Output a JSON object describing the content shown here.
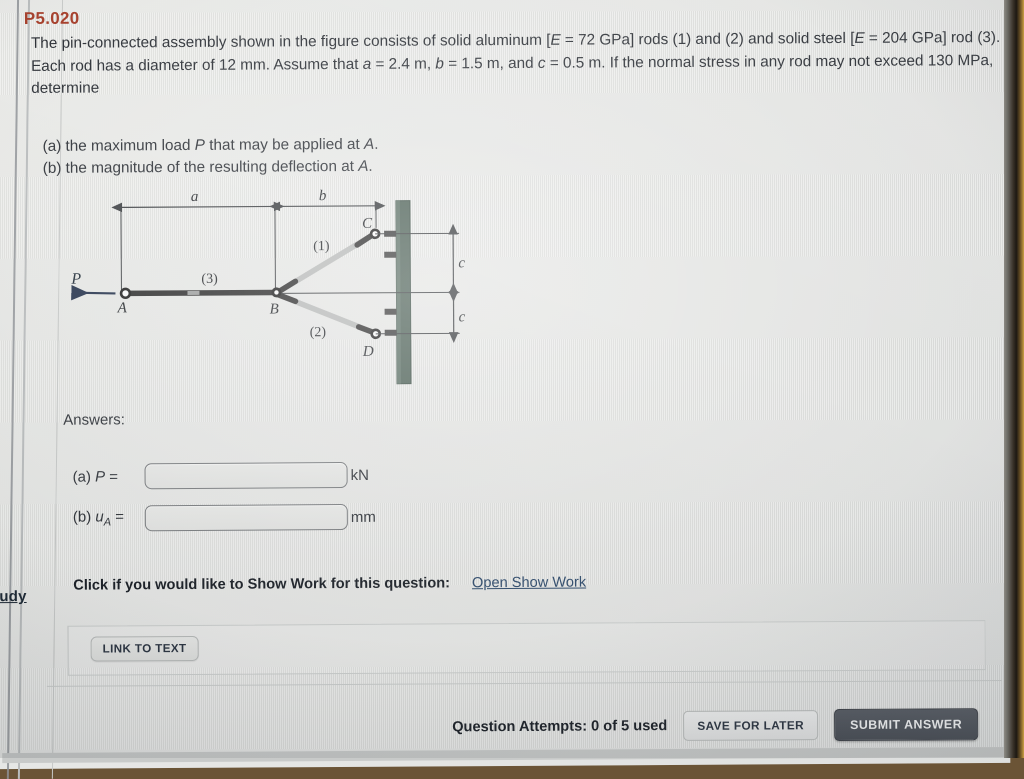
{
  "question": {
    "id": "P5.020",
    "id_color": "#a6402c",
    "statement_part1": "The pin-connected assembly shown in the figure consists of solid aluminum [",
    "statement_E1": "E",
    "statement_part2": " = 72 GPa] rods (1) and (2) and solid steel [",
    "statement_E2": "E",
    "statement_part3": " = 204 GPa] rod (3). Each rod has a diameter of 12 mm. Assume that ",
    "var_a": "a",
    "statement_part4": " = 2.4 m, ",
    "var_b": "b",
    "statement_part5": " = 1.5 m, and ",
    "var_c": "c",
    "statement_part6": " = 0.5 m. If the normal stress in any rod may not exceed 130 MPa, determine",
    "subquestions": [
      {
        "marker": "(a) the maximum load ",
        "italic": "P",
        "rest": " that may be applied at ",
        "italic2": "A",
        "end": "."
      },
      {
        "marker": "(b) the magnitude of the resulting deflection at ",
        "italic": "A",
        "rest": "",
        "italic2": "",
        "end": "."
      }
    ]
  },
  "figure": {
    "labels": {
      "dim_a": "a",
      "dim_b": "b",
      "dim_c_upper": "c",
      "dim_c_lower": "c",
      "load_P": "P",
      "joint_A": "A",
      "joint_B": "B",
      "joint_C": "C",
      "joint_D": "D",
      "rod1": "(1)",
      "rod2": "(2)",
      "rod3": "(3)"
    },
    "colors": {
      "wall": "#4d6157",
      "rod_dark": "#2b2b2b",
      "rod_light": "#b7b9b8",
      "line": "#3a3d40"
    }
  },
  "answers": {
    "heading": "Answers:",
    "rows": [
      {
        "label_prefix": "(a) ",
        "symbol": "P",
        "sub": "",
        "equals": " =",
        "value": "",
        "placeholder": "",
        "unit": "kN"
      },
      {
        "label_prefix": "(b) ",
        "symbol": "u",
        "sub": "A",
        "equals": " =",
        "value": "",
        "placeholder": "",
        "unit": "mm"
      }
    ]
  },
  "show_work": {
    "prompt": "Click if you would like to Show Work for this question:",
    "link": "Open Show Work"
  },
  "link_to_text": {
    "button_label": "LINK TO TEXT"
  },
  "footer": {
    "attempts": "Question Attempts: 0 of 5 used",
    "save_label": "SAVE FOR LATER",
    "submit_label": "SUBMIT ANSWER",
    "submit_bg": "#4a4f58"
  },
  "sidebar": {
    "clipped_link": "udy"
  }
}
